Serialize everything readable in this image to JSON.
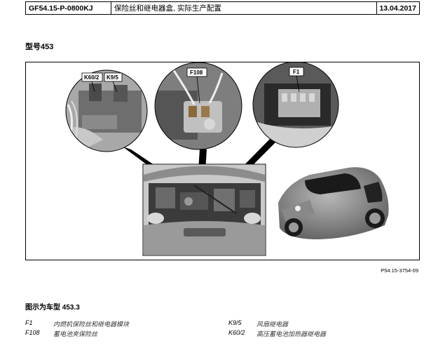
{
  "header": {
    "doc_id": "GF54.15-P-0800KJ",
    "title": "保险丝和继电器盒, 实际生产配置",
    "date": "13.04.2017"
  },
  "model_label": "型号453",
  "figure": {
    "callouts": [
      "K60/2",
      "K9/5",
      "F108",
      "F1"
    ],
    "figure_id": "P54.15-3754-09"
  },
  "caption": "图示为车型 453.3",
  "legend": [
    {
      "code": "F1",
      "desc": "内燃机保险丝和继电器模块"
    },
    {
      "code": "F108",
      "desc": "蓄电池夹保险丝"
    },
    {
      "code": "K9/5",
      "desc": "风扇继电器"
    },
    {
      "code": "K60/2",
      "desc": "高压蓄电池加热器继电器"
    }
  ]
}
